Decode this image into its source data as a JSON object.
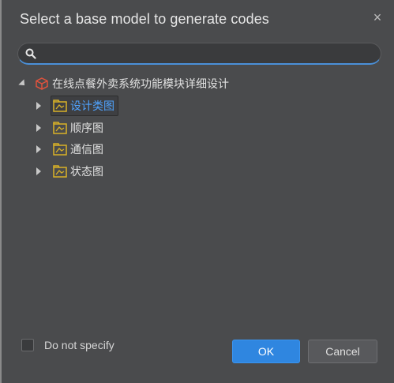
{
  "dialog": {
    "title": "Select a base model to generate codes",
    "close_symbol": "×"
  },
  "search": {
    "value": "",
    "placeholder": "",
    "icon": "search-icon"
  },
  "tree": {
    "root": {
      "label": "在线点餐外卖系统功能模块详细设计",
      "icon": "package-cube-icon",
      "expanded": true
    },
    "children": [
      {
        "label": "设计类图",
        "icon": "diagram-folder-icon",
        "selected": true
      },
      {
        "label": "顺序图",
        "icon": "diagram-folder-icon",
        "selected": false
      },
      {
        "label": "通信图",
        "icon": "diagram-folder-icon",
        "selected": false
      },
      {
        "label": "状态图",
        "icon": "diagram-folder-icon",
        "selected": false
      }
    ]
  },
  "footer": {
    "checkbox_label": "Do not specify",
    "checkbox_checked": false,
    "ok_label": "OK",
    "cancel_label": "Cancel"
  },
  "colors": {
    "background": "#4a4b4d",
    "accent": "#2f86e0",
    "selected_text": "#4fa3ff",
    "root_icon": "#e0533d",
    "folder_icon": "#d9b227"
  }
}
